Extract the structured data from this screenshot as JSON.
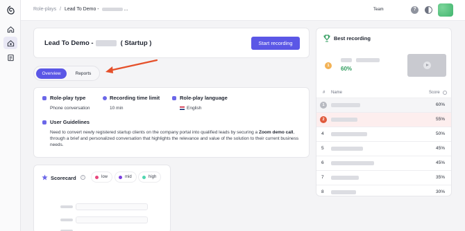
{
  "breadcrumb": {
    "parent": "Role-plays",
    "separator": "/",
    "current": "Lead To Demo -",
    "ellipsis": "..."
  },
  "topbar": {
    "team_label": "Team"
  },
  "header": {
    "title_prefix": "Lead To Demo -",
    "title_suffix": "( Startup )",
    "start_button": "Start recording"
  },
  "tabs": [
    {
      "label": "Overview",
      "active": true
    },
    {
      "label": "Reports",
      "active": false
    }
  ],
  "details": {
    "type_label": "Role-play type",
    "type_value": "Phone conversation",
    "time_label": "Recording time limit",
    "time_value": "10 min",
    "lang_label": "Role-play language",
    "lang_value": "English",
    "guidelines_label": "User Guidelines",
    "guidelines_pre": "Need to convert newly registered startup clients on the company portal into qualified leads by securing a ",
    "guidelines_bold": "Zoom demo call",
    "guidelines_post": ", through a brief and personalized conversation that highlights the relevance and value of the solution to their current business needs."
  },
  "scorecard": {
    "title": "Scorecard",
    "legend": [
      {
        "label": "low",
        "color": "#e8467c"
      },
      {
        "label": "mid",
        "color": "#7b3fe0"
      },
      {
        "label": "high",
        "color": "#4fd6b0"
      }
    ]
  },
  "best_recording": {
    "title": "Best recording",
    "top_score": "60%",
    "columns": {
      "rank": "#",
      "name": "Name",
      "score": "Score"
    },
    "rows": [
      {
        "rank": "1",
        "score": "60%"
      },
      {
        "rank": "2",
        "score": "55%"
      },
      {
        "rank": "4",
        "score": "50%"
      },
      {
        "rank": "5",
        "score": "45%"
      },
      {
        "rank": "6",
        "score": "45%"
      },
      {
        "rank": "7",
        "score": "35%"
      },
      {
        "rank": "8",
        "score": "30%"
      }
    ]
  },
  "colors": {
    "accent": "#5b57e6",
    "positive": "#2e9b5c",
    "arrow": "#e5502a"
  }
}
